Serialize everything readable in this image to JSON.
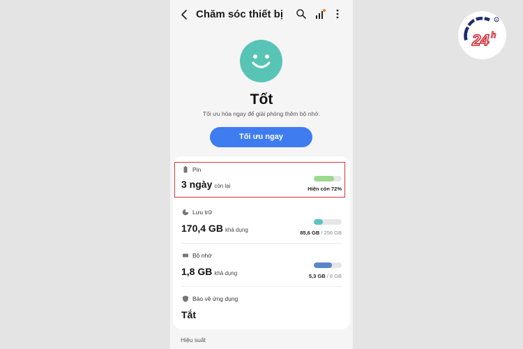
{
  "header": {
    "title": "Chăm sóc thiết bị"
  },
  "status": {
    "title": "Tốt",
    "description": "Tối ưu hóa ngay để giải phóng thêm bộ nhớ.",
    "button_label": "Tối ưu ngay"
  },
  "items": [
    {
      "label": "Pin",
      "icon": "battery-icon",
      "value": "3 ngày",
      "suffix": "còn lại",
      "bar_fraction": 0.72,
      "bar_color": "#9bd98e",
      "right_main": "Hiện còn 72%",
      "right_muted": ""
    },
    {
      "label": "Lưu trữ",
      "icon": "storage-pie-icon",
      "value": "170,4 GB",
      "suffix": "khả dụng",
      "bar_fraction": 0.33,
      "bar_color": "#5cc2c4",
      "right_main": "85,6 GB",
      "right_muted": " / 256 GB"
    },
    {
      "label": "Bộ nhớ",
      "icon": "memory-chip-icon",
      "value": "1,8 GB",
      "suffix": "khả dụng",
      "bar_fraction": 0.66,
      "bar_color": "#5b86c9",
      "right_main": "5,3 GB",
      "right_muted": " / 8 GB"
    },
    {
      "label": "Bảo vệ ứng dụng",
      "icon": "shield-icon",
      "value": "Tắt"
    }
  ],
  "section_title": "Hiệu suất",
  "logo_text": "24h",
  "colors": {
    "accent": "#3e7cf0",
    "smiley": "#57c4b6",
    "highlight": "#d4343c"
  }
}
